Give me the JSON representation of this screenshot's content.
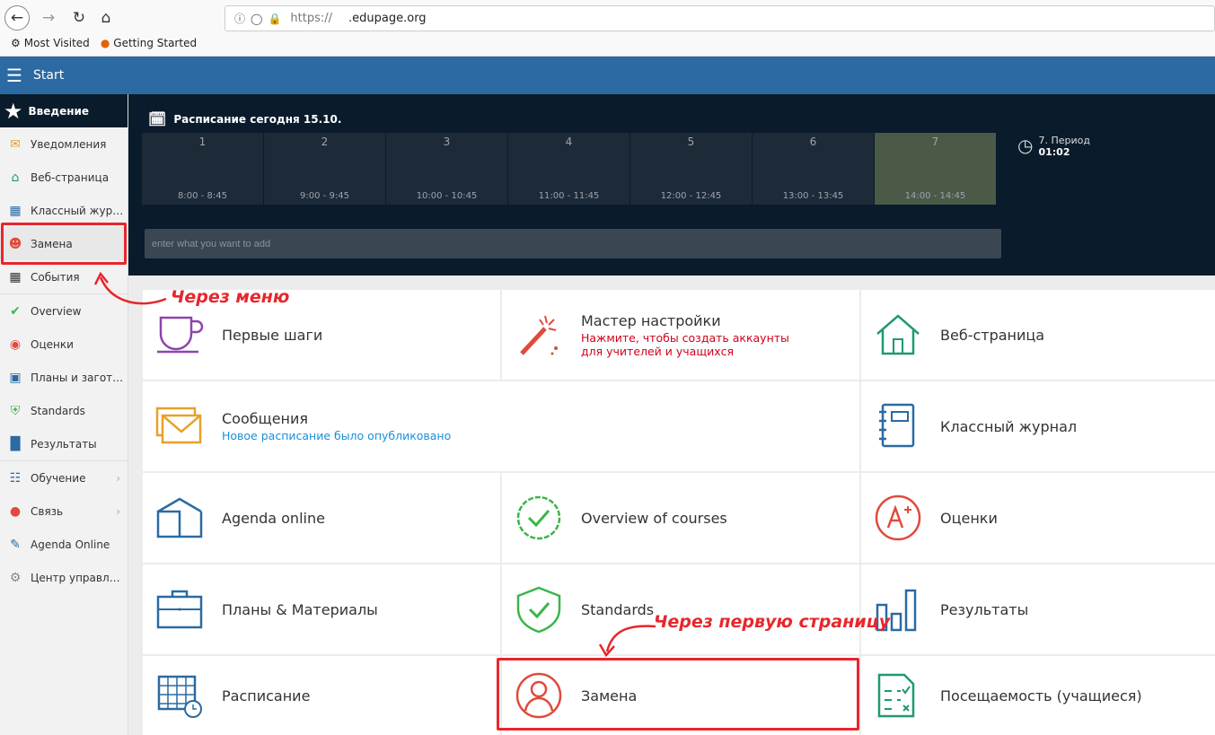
{
  "browser": {
    "url_protocol": "https://",
    "url_domain": ".edupage.org",
    "bookmarks": [
      {
        "icon": "gear-icon",
        "label": "Most Visited"
      },
      {
        "icon": "firefox-icon",
        "label": "Getting Started"
      }
    ]
  },
  "appbar": {
    "title": "Start"
  },
  "sidebar": {
    "header": "Введение",
    "items": [
      {
        "label": "Уведомления",
        "icon": "mail-icon",
        "color": "#e8a12a"
      },
      {
        "label": "Веб-страница",
        "icon": "house-icon",
        "color": "#1f9a6e"
      },
      {
        "label": "Классный жур…",
        "icon": "notebook-icon",
        "color": "#2b6aa3"
      },
      {
        "label": "Замена",
        "icon": "person-icon",
        "color": "#e04a3c"
      },
      {
        "label": "События",
        "icon": "calendar-icon",
        "color": "#333333"
      },
      {
        "label": "Overview",
        "icon": "check-circle-icon",
        "color": "#3bb54a"
      },
      {
        "label": "Оценки",
        "icon": "grade-icon",
        "color": "#e04a3c"
      },
      {
        "label": "Планы и загот…",
        "icon": "briefcase-icon",
        "color": "#2b6aa3"
      },
      {
        "label": "Standards",
        "icon": "shield-icon",
        "color": "#3bb54a"
      },
      {
        "label": "Результаты",
        "icon": "bar-chart-icon",
        "color": "#2b6aa3"
      },
      {
        "label": "Обучение",
        "icon": "book-icon",
        "color": "#2b6aa3"
      },
      {
        "label": "Связь",
        "icon": "chat-icon",
        "color": "#e04a3c"
      },
      {
        "label": "Agenda Online",
        "icon": "pen-icon",
        "color": "#2b6aa3"
      },
      {
        "label": "Центр управл…",
        "icon": "gear-icon",
        "color": "#888888"
      }
    ]
  },
  "schedule": {
    "title": "Расписание сегодня 15.10.",
    "periods": [
      {
        "num": "1",
        "time": "8:00 - 8:45"
      },
      {
        "num": "2",
        "time": "9:00 - 9:45"
      },
      {
        "num": "3",
        "time": "10:00 - 10:45"
      },
      {
        "num": "4",
        "time": "11:00 - 11:45"
      },
      {
        "num": "5",
        "time": "12:00 - 12:45"
      },
      {
        "num": "6",
        "time": "13:00 - 13:45"
      },
      {
        "num": "7",
        "time": "14:00 - 14:45"
      }
    ],
    "current_label": "7. Период",
    "current_time": "01:02",
    "add_placeholder": "enter what you want to add"
  },
  "tiles": {
    "first_steps": "Первые шаги",
    "wizard": "Мастер настройки",
    "wizard_sub": "Нажмите, чтобы создать аккаунты для учителей и учащихся",
    "website": "Веб-страница",
    "messages": "Сообщения",
    "messages_sub": "Новое расписание было опубликовано",
    "class_journal": "Классный журнал",
    "agenda": "Agenda online",
    "overview": "Overview of courses",
    "grades": "Оценки",
    "plans": "Планы & Материалы",
    "standards": "Standards",
    "results": "Результаты",
    "timetable": "Расписание",
    "substitution": "Замена",
    "attendance": "Посещаемость (учащиеся)"
  },
  "annotations": {
    "via_menu": "Через меню",
    "via_first_page": "Через первую страницу",
    "color": "#e8262c"
  }
}
